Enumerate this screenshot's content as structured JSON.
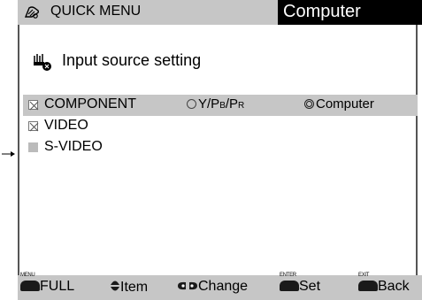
{
  "header": {
    "menu_title": "QUICK MENU",
    "current_source": "Computer"
  },
  "section": {
    "title": "Input source setting"
  },
  "sources": [
    {
      "label": "COMPONENT",
      "checked": true,
      "highlighted": true,
      "options": [
        "Y/PB/PR",
        "Computer"
      ],
      "selected_option": "Computer"
    },
    {
      "label": "VIDEO",
      "checked": true
    },
    {
      "label": "S-VIDEO",
      "checked": false,
      "disabled": true
    }
  ],
  "option_labels": {
    "ypbpr_y": "Y/P",
    "ypbpr_b": "B",
    "ypbpr_sep": "/P",
    "ypbpr_r": "R",
    "computer": "Computer"
  },
  "footer": {
    "full": {
      "key": "MENU",
      "label": "FULL"
    },
    "item": {
      "label": "Item"
    },
    "change": {
      "label": "Change"
    },
    "set": {
      "key": "ENTER",
      "label": "Set"
    },
    "back": {
      "key": "EXIT",
      "label": "Back"
    }
  },
  "colors": {
    "bar_bg": "#c6c6c6",
    "source_box_bg": "#000000",
    "source_box_text": "#ffffff"
  },
  "icons": {
    "menu": "tv-menu-icon",
    "section": "input-source-icon",
    "pointer": "arrow-pointer-icon"
  }
}
